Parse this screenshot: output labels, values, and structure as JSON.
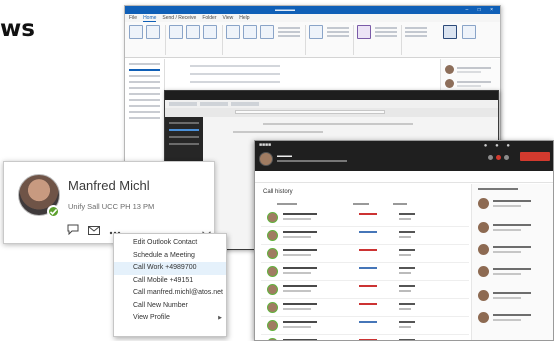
{
  "page": {
    "title_fragment": "ws"
  },
  "outlook": {
    "menu_tabs": [
      "File",
      "Home",
      "Send / Receive",
      "Folder",
      "View",
      "Help"
    ],
    "active_tab": "Home"
  },
  "contact_card": {
    "name": "Manfred Michl",
    "status": "Unify Sall UCC PH 13 PM",
    "presence_color": "#5ba02c",
    "action_icons": [
      "chat-icon",
      "mail-icon",
      "more-icon"
    ],
    "expand_icon": "chevron-down-icon"
  },
  "context_menu": {
    "items": [
      {
        "label": "Edit Outlook Contact"
      },
      {
        "label": "Schedule a Meeting"
      },
      {
        "label": "Call Work +4989700"
      },
      {
        "label": "Call Mobile +49151"
      },
      {
        "label": "Call manfred.michl@atos.net"
      },
      {
        "label": "Call New Number"
      },
      {
        "label": "View Profile",
        "submenu": true
      }
    ],
    "highlight_color": "#e5f1fb"
  },
  "unify_app": {
    "section_title": "Call history",
    "accent_color": "#d23a2e"
  }
}
